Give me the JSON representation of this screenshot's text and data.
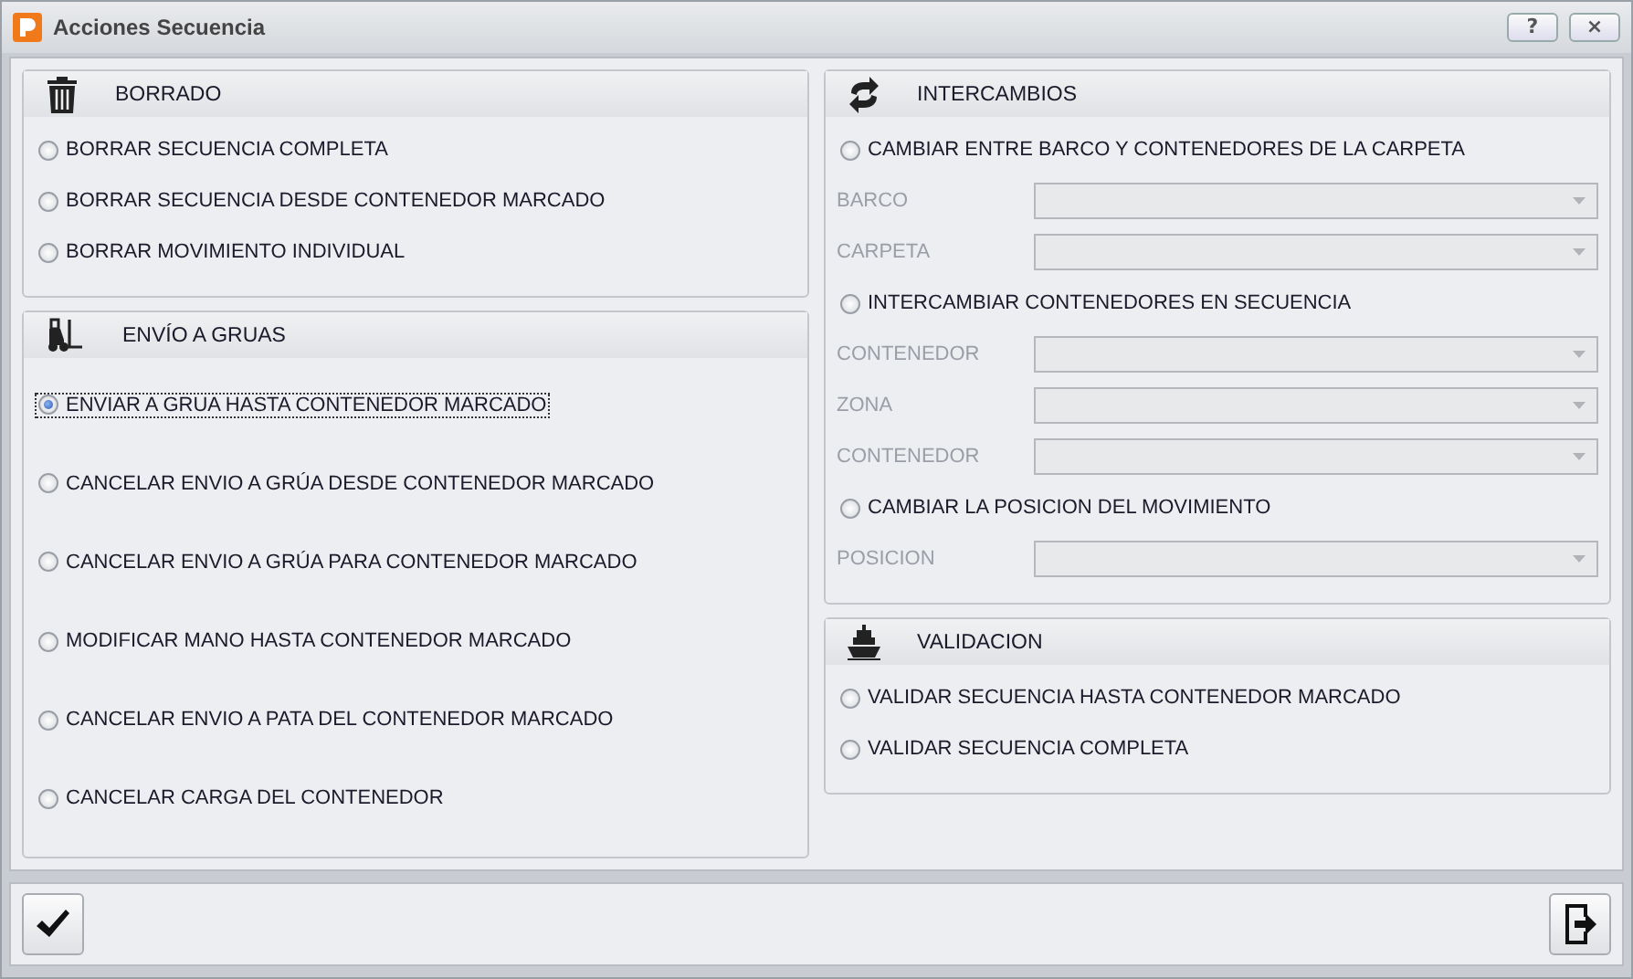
{
  "window": {
    "title": "Acciones Secuencia",
    "buttons": [
      "?",
      "×"
    ]
  },
  "left": [
    {
      "title": "BORRADO",
      "kind": "trash",
      "items": [
        {
          "kind": "option",
          "label": "BORRAR SECUENCIA COMPLETA",
          "selected": false
        },
        {
          "kind": "option",
          "label": "BORRAR SECUENCIA DESDE CONTENEDOR MARCADO",
          "selected": false
        },
        {
          "kind": "option",
          "label": "BORRAR MOVIMIENTO INDIVIDUAL",
          "selected": false
        }
      ]
    },
    {
      "title": "ENVÍO A GRUAS",
      "kind": "forklift",
      "items": [
        {
          "kind": "option",
          "label": "ENVIAR A GRUA HASTA CONTENEDOR MARCADO",
          "selected": true
        },
        {
          "kind": "option",
          "label": "CANCELAR ENVIO A GRÚA DESDE CONTENEDOR MARCADO",
          "selected": false
        },
        {
          "kind": "option",
          "label": "CANCELAR ENVIO A GRÚA PARA CONTENEDOR MARCADO",
          "selected": false
        },
        {
          "kind": "option",
          "label": "MODIFICAR MANO HASTA CONTENEDOR MARCADO",
          "selected": false
        },
        {
          "kind": "option",
          "label": "CANCELAR ENVIO A PATA DEL CONTENEDOR MARCADO",
          "selected": false
        },
        {
          "kind": "option",
          "label": "CANCELAR CARGA DEL CONTENEDOR",
          "selected": false
        }
      ]
    }
  ],
  "right": [
    {
      "title": "INTERCAMBIOS",
      "kind": "swap",
      "items": [
        {
          "kind": "option",
          "label": "CAMBIAR ENTRE BARCO Y CONTENEDORES DE LA CARPETA",
          "selected": false
        },
        {
          "kind": "field",
          "label": "BARCO",
          "disabled": true
        },
        {
          "kind": "field",
          "label": "CARPETA",
          "disabled": true
        },
        {
          "kind": "option",
          "label": "INTERCAMBIAR CONTENEDORES EN SECUENCIA",
          "selected": false
        },
        {
          "kind": "field",
          "label": "CONTENEDOR",
          "disabled": true
        },
        {
          "kind": "field",
          "label": "ZONA",
          "disabled": true
        },
        {
          "kind": "field",
          "label": "CONTENEDOR",
          "disabled": true
        },
        {
          "kind": "option",
          "label": "CAMBIAR LA POSICION DEL MOVIMIENTO",
          "selected": false
        },
        {
          "kind": "field",
          "label": "POSICION",
          "disabled": true
        }
      ]
    },
    {
      "title": "VALIDACION",
      "kind": "ship",
      "items": [
        {
          "kind": "option",
          "label": "VALIDAR SECUENCIA HASTA CONTENEDOR MARCADO",
          "selected": false
        },
        {
          "kind": "option",
          "label": "VALIDAR SECUENCIA COMPLETA",
          "selected": false
        }
      ]
    }
  ],
  "footer": {
    "buttons": [
      {
        "kind": "accept"
      },
      {
        "kind": "exit"
      }
    ]
  }
}
